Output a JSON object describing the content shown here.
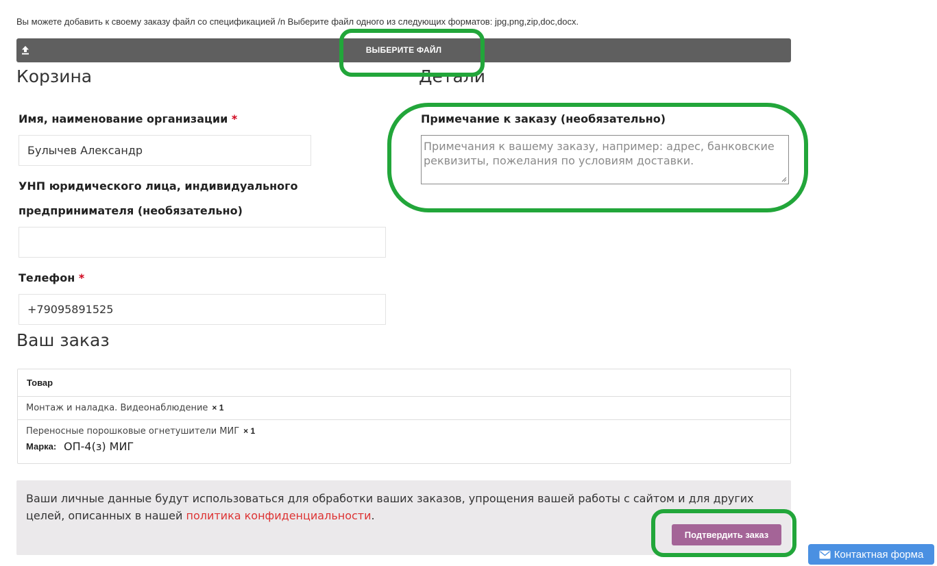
{
  "upload": {
    "info": "Вы можете добавить к своему заказу файл со спецификацией /n Выберите файл одного из следующих форматов: jpg,png,zip,doc,docx.",
    "button_label": "ВЫБЕРИТЕ ФАЙЛ"
  },
  "cart": {
    "title": "Корзина",
    "name_label": "Имя, наименование организации",
    "name_value": "Булычев Александр",
    "unp_label_line1": "УНП юридического лица, индивидуального",
    "unp_label_line2": "предпринимателя  (необязательно)",
    "unp_value": "",
    "phone_label": "Телефон",
    "phone_value": "+79095891525",
    "required_mark": "*"
  },
  "details": {
    "title": "Детали",
    "notes_label": "Примечание к заказу (необязательно)",
    "notes_placeholder": "Примечания к вашему заказу, например: адрес, банковские реквизиты, пожелания по условиям доставки."
  },
  "order": {
    "title": "Ваш заказ",
    "column_header": "Товар",
    "items": [
      {
        "name": "Монтаж и наладка. Видеонаблюдение",
        "qty": "× 1"
      },
      {
        "name": "Переносные порошковые огнетушители МИГ",
        "qty": "× 1",
        "meta_key": "Марка:",
        "meta_value": "ОП-4(з) МИГ"
      }
    ]
  },
  "privacy": {
    "text_before": "Ваши личные данные будут использоваться для обработки ваших заказов, упрощения вашей работы с сайтом и для других целей, описанных в нашей ",
    "link_text": "политика конфиденциальности",
    "text_after": "."
  },
  "confirm_label": "Подтвердить заказ",
  "contact_label": "Контактная форма",
  "colors": {
    "highlight": "#22a63a",
    "confirm_button": "#a46497",
    "contact_button": "#4a90e2",
    "required": "#d0021b",
    "link": "#dd3333"
  }
}
